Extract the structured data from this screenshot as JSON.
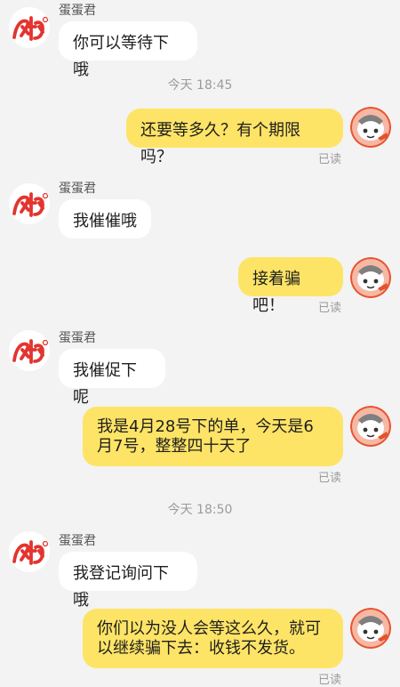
{
  "messages": [
    {
      "name": "蛋蛋君",
      "text": "你可以等待下哦"
    },
    {
      "time": "今天 18:45"
    },
    {
      "text": "还要等多久？有个期限吗？",
      "status": "已读"
    },
    {
      "name": "蛋蛋君",
      "text": "我催催哦"
    },
    {
      "text": "接着骗吧！",
      "status": "已读"
    },
    {
      "name": "蛋蛋君",
      "text": "我催促下呢"
    },
    {
      "text": "我是4月28号下的单，今天是6\n月7号，整整四十天了",
      "status": "已读"
    },
    {
      "time": "今天 18:50"
    },
    {
      "name": "蛋蛋君",
      "text": "我登记询问下哦"
    },
    {
      "text": "你们以为没人会等这么久，就可\n以继续骗下去：收钱不发货。",
      "status": "已读"
    }
  ],
  "shop_avatar": {
    "icon": "shop-logo-icon",
    "text": "蛋蛋",
    "color": "#e3342f"
  },
  "user_avatar": {
    "icon": "user-avatar-icon",
    "color": "#e9522e"
  },
  "colors": {
    "background": "#f3f3f3",
    "incoming_bubble": "#ffffff",
    "outgoing_bubble": "#fde466"
  }
}
